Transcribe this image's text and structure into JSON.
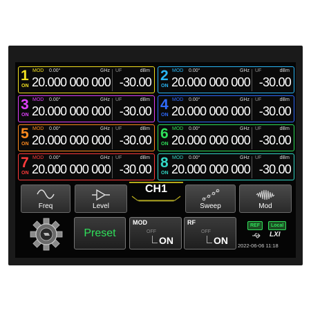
{
  "channels": [
    {
      "num": "1",
      "color": "#f2e020",
      "on": "ON",
      "mod": "MOD",
      "phase": "0.00°",
      "freq_unit": "GHz",
      "uf": "UF",
      "level_unit": "dBm",
      "freq": "20.000 000 000",
      "level": "-30.00"
    },
    {
      "num": "2",
      "color": "#29b6f6",
      "on": "ON",
      "mod": "MOD",
      "phase": "0.00°",
      "freq_unit": "GHz",
      "uf": "UF",
      "level_unit": "dBm",
      "freq": "20.000 000 000",
      "level": "-30.00"
    },
    {
      "num": "3",
      "color": "#e040fb",
      "on": "ON",
      "mod": "MOD",
      "phase": "0.00°",
      "freq_unit": "GHz",
      "uf": "UF",
      "level_unit": "dBm",
      "freq": "20.000 000 000",
      "level": "-30.00"
    },
    {
      "num": "4",
      "color": "#2f6bff",
      "on": "ON",
      "mod": "MOD",
      "phase": "0.00°",
      "freq_unit": "GHz",
      "uf": "UF",
      "level_unit": "dBm",
      "freq": "20.000 000 000",
      "level": "-30.00"
    },
    {
      "num": "5",
      "color": "#ff8a1e",
      "on": "ON",
      "mod": "MOD",
      "phase": "0.00°",
      "freq_unit": "GHz",
      "uf": "UF",
      "level_unit": "dBm",
      "freq": "20.000 000 000",
      "level": "-30.00"
    },
    {
      "num": "6",
      "color": "#2fe05a",
      "on": "ON",
      "mod": "MOD",
      "phase": "0.00°",
      "freq_unit": "GHz",
      "uf": "UF",
      "level_unit": "dBm",
      "freq": "20.000 000 000",
      "level": "-30.00"
    },
    {
      "num": "7",
      "color": "#ff3b3b",
      "on": "ON",
      "mod": "MOD",
      "phase": "0.00°",
      "freq_unit": "GHz",
      "uf": "UF",
      "level_unit": "dBm",
      "freq": "20.000 000 000",
      "level": "-30.00"
    },
    {
      "num": "8",
      "color": "#32d6c4",
      "on": "ON",
      "mod": "MOD",
      "phase": "0.00°",
      "freq_unit": "GHz",
      "uf": "UF",
      "level_unit": "dBm",
      "freq": "20.000 000 000",
      "level": "-30.00"
    }
  ],
  "toolbar": {
    "freq": "Freq",
    "level": "Level",
    "active_channel": "CH1",
    "sweep": "Sweep",
    "mod": "Mod"
  },
  "bottom": {
    "preset": "Preset",
    "mod_title": "MOD",
    "rf_title": "RF",
    "off": "OFF",
    "on": "ON",
    "ref": "REF",
    "local": "Local",
    "lxi": "LXI",
    "timestamp": "2022-06-06 11:18"
  },
  "icons": {
    "freq": "sine-wave-icon",
    "level": "amplifier-icon",
    "sweep": "sweep-points-icon",
    "mod": "modulated-wave-icon",
    "settings": "gear-icon",
    "usb": "usb-icon"
  },
  "colors": {
    "accent": "#f2e020",
    "preset": "#2fe05a"
  }
}
